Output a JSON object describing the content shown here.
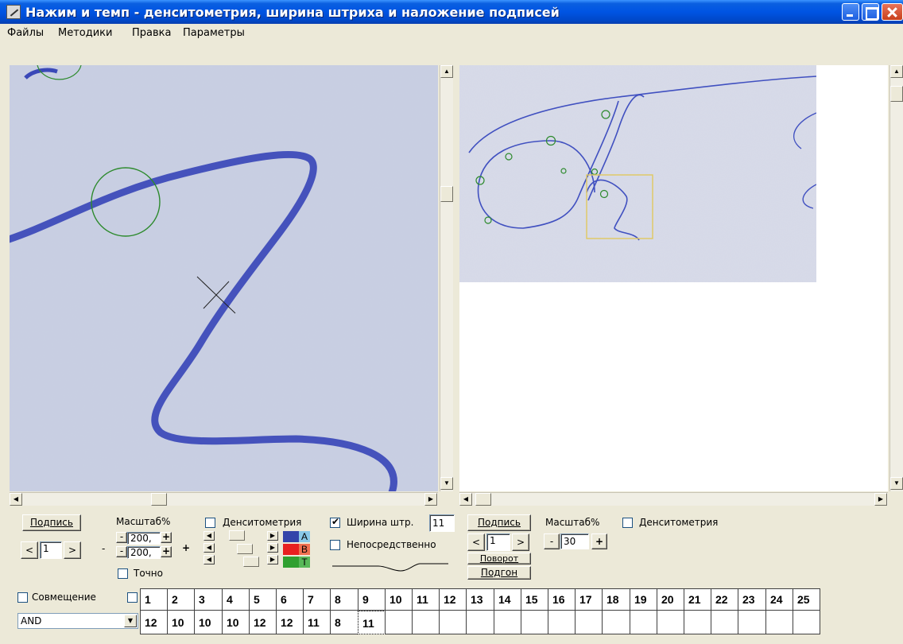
{
  "window": {
    "title": "Нажим и темп - денситометрия, ширина штриха и наложение подписей"
  },
  "menu": [
    "Файлы",
    "Методики",
    "Правка",
    "Параметры"
  ],
  "left_controls": {
    "signature_button": "Подпись",
    "signature_index": "1",
    "prev": "<",
    "next": ">",
    "scale_label": "Масштаб%",
    "scale_x": "200,",
    "scale_y": "200,",
    "minus": "-",
    "plus": "+",
    "exact_label": "Точно",
    "exact_checked": false,
    "densitometry_label": "Денситометрия",
    "densitometry_checked": false,
    "stroke_width_label": "Ширина штр.",
    "stroke_width_checked": true,
    "stroke_width_value": "11",
    "direct_label": "Непосредственно",
    "direct_checked": false,
    "channels": [
      {
        "letter": "A",
        "swatch_color": "#3344aa",
        "letter_bg": "#89c8e8"
      },
      {
        "letter": "B",
        "swatch_color": "#e82020",
        "letter_bg": "#f07050"
      },
      {
        "letter": "T",
        "swatch_color": "#30a030",
        "letter_bg": "#58b858"
      }
    ]
  },
  "right_controls": {
    "signature_button": "Подпись",
    "signature_index": "1",
    "prev": "<",
    "next": ">",
    "scale_label": "Масштаб%",
    "scale_value": "30",
    "minus": "-",
    "plus": "+",
    "densitometry_label": "Денситометрия",
    "densitometry_checked": false,
    "rotate_button": "Поворот",
    "fit_button": "Подгон"
  },
  "grid": {
    "overlay_label": "Совмещение",
    "overlay_checked": false,
    "overlay_checked_2": false,
    "mode_select": "AND",
    "headers": [
      "1",
      "2",
      "3",
      "4",
      "5",
      "6",
      "7",
      "8",
      "9",
      "10",
      "11",
      "12",
      "13",
      "14",
      "15",
      "16",
      "17",
      "18",
      "19",
      "20",
      "21",
      "22",
      "23",
      "24",
      "25"
    ],
    "values": [
      "12",
      "10",
      "10",
      "10",
      "12",
      "12",
      "11",
      "8",
      "11",
      "",
      "",
      "",
      "",
      "",
      "",
      "",
      "",
      "",
      "",
      "",
      "",
      "",
      "",
      "",
      ""
    ]
  },
  "colors": {
    "ink": "#3a48b8",
    "marker": "#2d8a2d",
    "selection_box": "#e0c860"
  }
}
